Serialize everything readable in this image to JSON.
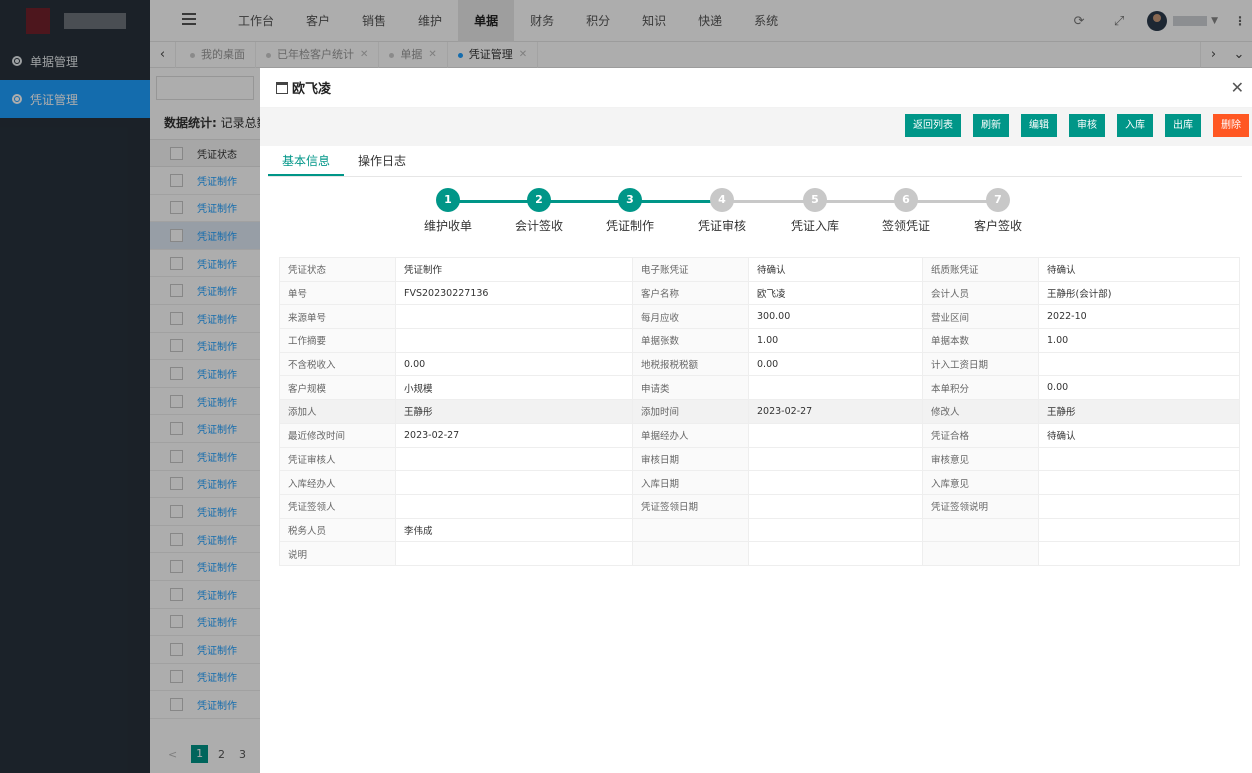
{
  "sidebar": {
    "items": [
      {
        "label": "单据管理",
        "active": false
      },
      {
        "label": "凭证管理",
        "active": true
      }
    ]
  },
  "topnav": {
    "items": [
      "工作台",
      "客户",
      "销售",
      "维护",
      "单据",
      "财务",
      "积分",
      "知识",
      "快递",
      "系统"
    ],
    "active": "单据"
  },
  "tabs": [
    {
      "label": "我的桌面",
      "active": false
    },
    {
      "label": "已年检客户统计",
      "active": false
    },
    {
      "label": "单据",
      "active": false
    },
    {
      "label": "凭证管理",
      "active": true
    }
  ],
  "background_list": {
    "stats_label": "数据统计:",
    "stats_text": "记录总数",
    "column_header": "凭证状态",
    "row_value": "凭证制作",
    "row_count": 20,
    "pager": {
      "prev": "<",
      "pages": [
        "1",
        "2",
        "3"
      ]
    }
  },
  "panel": {
    "title": "欧飞凌",
    "buttons": [
      "返回列表",
      "刷新",
      "编辑",
      "审核",
      "入库",
      "出库",
      "删除"
    ],
    "subtabs": [
      "基本信息",
      "操作日志"
    ],
    "steps": [
      {
        "num": "1",
        "label": "维护收单",
        "done": true
      },
      {
        "num": "2",
        "label": "会计签收",
        "done": true
      },
      {
        "num": "3",
        "label": "凭证制作",
        "done": true
      },
      {
        "num": "4",
        "label": "凭证审核",
        "done": false
      },
      {
        "num": "5",
        "label": "凭证入库",
        "done": false
      },
      {
        "num": "6",
        "label": "签领凭证",
        "done": false
      },
      {
        "num": "7",
        "label": "客户签收",
        "done": false
      }
    ],
    "info_rows": [
      [
        "凭证状态",
        "凭证制作",
        "电子账凭证",
        "待确认",
        "纸质账凭证",
        "待确认"
      ],
      [
        "单号",
        "FVS20230227136",
        "客户名称",
        "欧飞凌",
        "会计人员",
        "王静彤(会计部)"
      ],
      [
        "来源单号",
        "",
        "每月应收",
        "300.00",
        "营业区间",
        "2022-10"
      ],
      [
        "工作摘要",
        "",
        "单据张数",
        "1.00",
        "单据本数",
        "1.00"
      ],
      [
        "不含税收入",
        "0.00",
        "地税报税税额",
        "0.00",
        "计入工资日期",
        ""
      ],
      [
        "客户规模",
        "小规模",
        "申请类",
        "",
        "本单积分",
        "0.00"
      ],
      [
        "添加人",
        "王静彤",
        "添加时间",
        "2023-02-27",
        "修改人",
        "王静彤"
      ],
      [
        "最近修改时间",
        "2023-02-27",
        "单据经办人",
        "",
        "凭证合格",
        "待确认"
      ],
      [
        "凭证审核人",
        "",
        "审核日期",
        "",
        "审核意见",
        ""
      ],
      [
        "入库经办人",
        "",
        "入库日期",
        "",
        "入库意见",
        ""
      ],
      [
        "凭证签领人",
        "",
        "凭证签领日期",
        "",
        "凭证签领说明",
        ""
      ],
      [
        "税务人员",
        "李伟成",
        "",
        "",
        "",
        ""
      ],
      [
        "说明",
        "",
        "",
        "",
        "",
        ""
      ]
    ]
  },
  "colors": {
    "primary": "#009688",
    "danger": "#ff5722",
    "sidebar": "#28323c",
    "sidebar_active": "#1e9fff",
    "step_todo": "#c8c8c8"
  }
}
